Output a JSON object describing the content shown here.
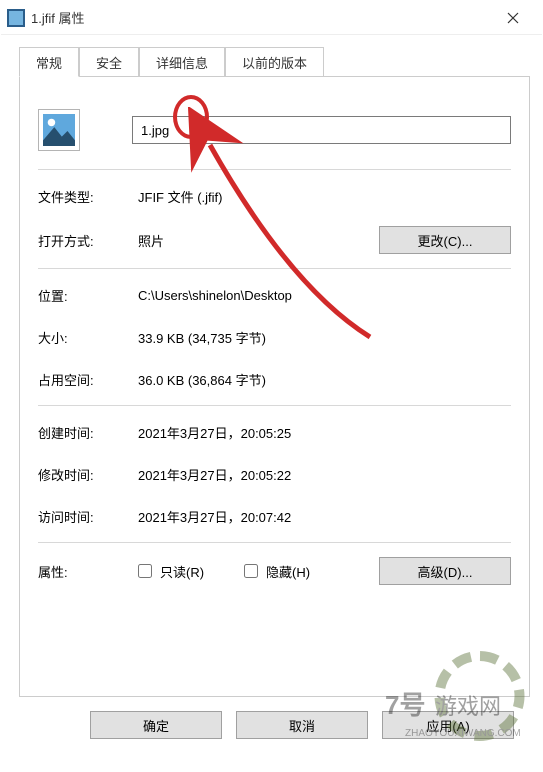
{
  "window": {
    "title": "1.jfif 属性"
  },
  "tabs": {
    "items": [
      {
        "label": "常规",
        "active": true
      },
      {
        "label": "安全",
        "active": false
      },
      {
        "label": "详细信息",
        "active": false
      },
      {
        "label": "以前的版本",
        "active": false
      }
    ]
  },
  "general": {
    "filename": "1.jpg",
    "rows": {
      "filetype_label": "文件类型:",
      "filetype_value": "JFIF 文件 (.jfif)",
      "openswith_label": "打开方式:",
      "openswith_value": "照片",
      "change_button": "更改(C)...",
      "location_label": "位置:",
      "location_value": "C:\\Users\\shinelon\\Desktop",
      "size_label": "大小:",
      "size_value": "33.9 KB (34,735 字节)",
      "sizeondisk_label": "占用空间:",
      "sizeondisk_value": "36.0 KB (36,864 字节)",
      "created_label": "创建时间:",
      "created_value": "2021年3月27日，20:05:25",
      "modified_label": "修改时间:",
      "modified_value": "2021年3月27日，20:05:22",
      "accessed_label": "访问时间:",
      "accessed_value": "2021年3月27日，20:07:42",
      "attributes_label": "属性:",
      "readonly_label": "只读(R)",
      "hidden_label": "隐藏(H)",
      "advanced_button": "高级(D)..."
    }
  },
  "footer": {
    "ok": "确定",
    "cancel": "取消",
    "apply": "应用(A)"
  },
  "annotation": {
    "ellipse_target": "jpg-extension",
    "arrow_color": "#d12a2a"
  },
  "watermark": {
    "brand": "7号游戏网",
    "domain": "ZHAOYOUXIWANG.COM"
  }
}
